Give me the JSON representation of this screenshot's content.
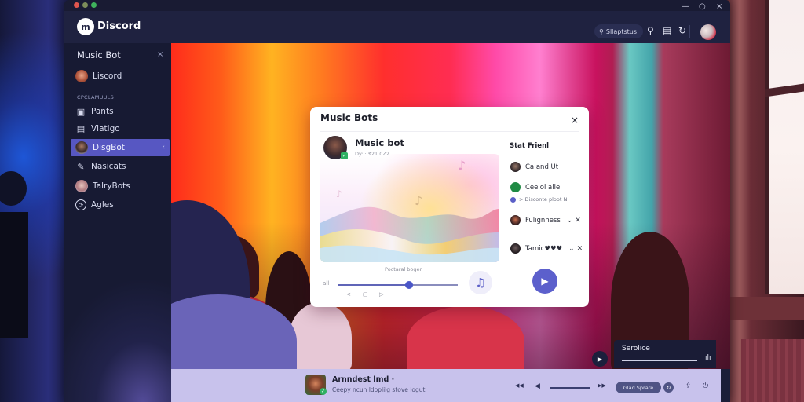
{
  "window": {
    "controls": {
      "minimize": "—",
      "maximize": "○",
      "close": "×"
    }
  },
  "header": {
    "app_name": "Discord",
    "logo_glyph": "m",
    "search_label": "Sllaptstus",
    "icons": [
      "search-icon",
      "inbox-icon",
      "refresh-icon"
    ]
  },
  "sidebar": {
    "title": "Music Bot",
    "close_glyph": "×",
    "section_label": "CPCLAMUULS",
    "items": [
      {
        "label": "Liscord",
        "icon": "avatar",
        "active": false
      },
      {
        "label": "Pants",
        "icon": "image-icon",
        "active": false
      },
      {
        "label": "Vlatigo",
        "icon": "screen-icon",
        "active": false
      },
      {
        "label": "DisgBot",
        "icon": "avatar",
        "active": true
      },
      {
        "label": "Nasicats",
        "icon": "pencil-icon",
        "active": false
      },
      {
        "label": "TalryBots",
        "icon": "avatar",
        "active": false
      },
      {
        "label": "Agles",
        "icon": "compass-icon",
        "active": false
      }
    ],
    "active_chevron": "‹"
  },
  "modal": {
    "title": "Music Bots",
    "close_glyph": "×",
    "bot": {
      "name": "Music bot",
      "subtitle": "Dy: · ₹21 0Z2",
      "badge_glyph": "✓"
    },
    "progress_label": "Poctaral boger",
    "volume_label": "all",
    "progress_fraction": 0.59,
    "small_controls": [
      "<",
      "▢",
      "▷"
    ],
    "note_button_glyph": "♫",
    "notes": [
      "♪",
      "♪",
      "♪"
    ],
    "friends": {
      "title": "Stat Frienl",
      "items": [
        {
          "name": "Ca and Ut",
          "controls": ""
        },
        {
          "name": "Ceelol alle",
          "controls": ""
        },
        {
          "name": "Fulignness",
          "controls": "⌄ ✕"
        },
        {
          "name": "Tamic♥♥♥",
          "controls": "⌄ ✕"
        }
      ],
      "sub_text": "> Disconte ploot Nl"
    },
    "play_glyph": "▶"
  },
  "mini_player": {
    "title": "Serolice",
    "eq_glyph": "ılı",
    "play_glyph": "▶"
  },
  "now_playing": {
    "title": "Arnndest lmd ·",
    "subtitle": "Ceepy ncun ldoplilg stove logut",
    "badge_glyph": "✓",
    "controls": {
      "rewind": "◀◀",
      "volume": "◀",
      "forward": "▶▶",
      "pill_label": "Glad Sprare",
      "sync": "↻",
      "share": "⇪",
      "power": "⏻"
    }
  },
  "colors": {
    "accent": "#5c60cc",
    "sidebar_bg": "#171a33",
    "header_bg": "#1f2240",
    "active_item": "#5757c2",
    "bottom_bar": "#c8c2ec",
    "online_badge": "#2fb062"
  }
}
